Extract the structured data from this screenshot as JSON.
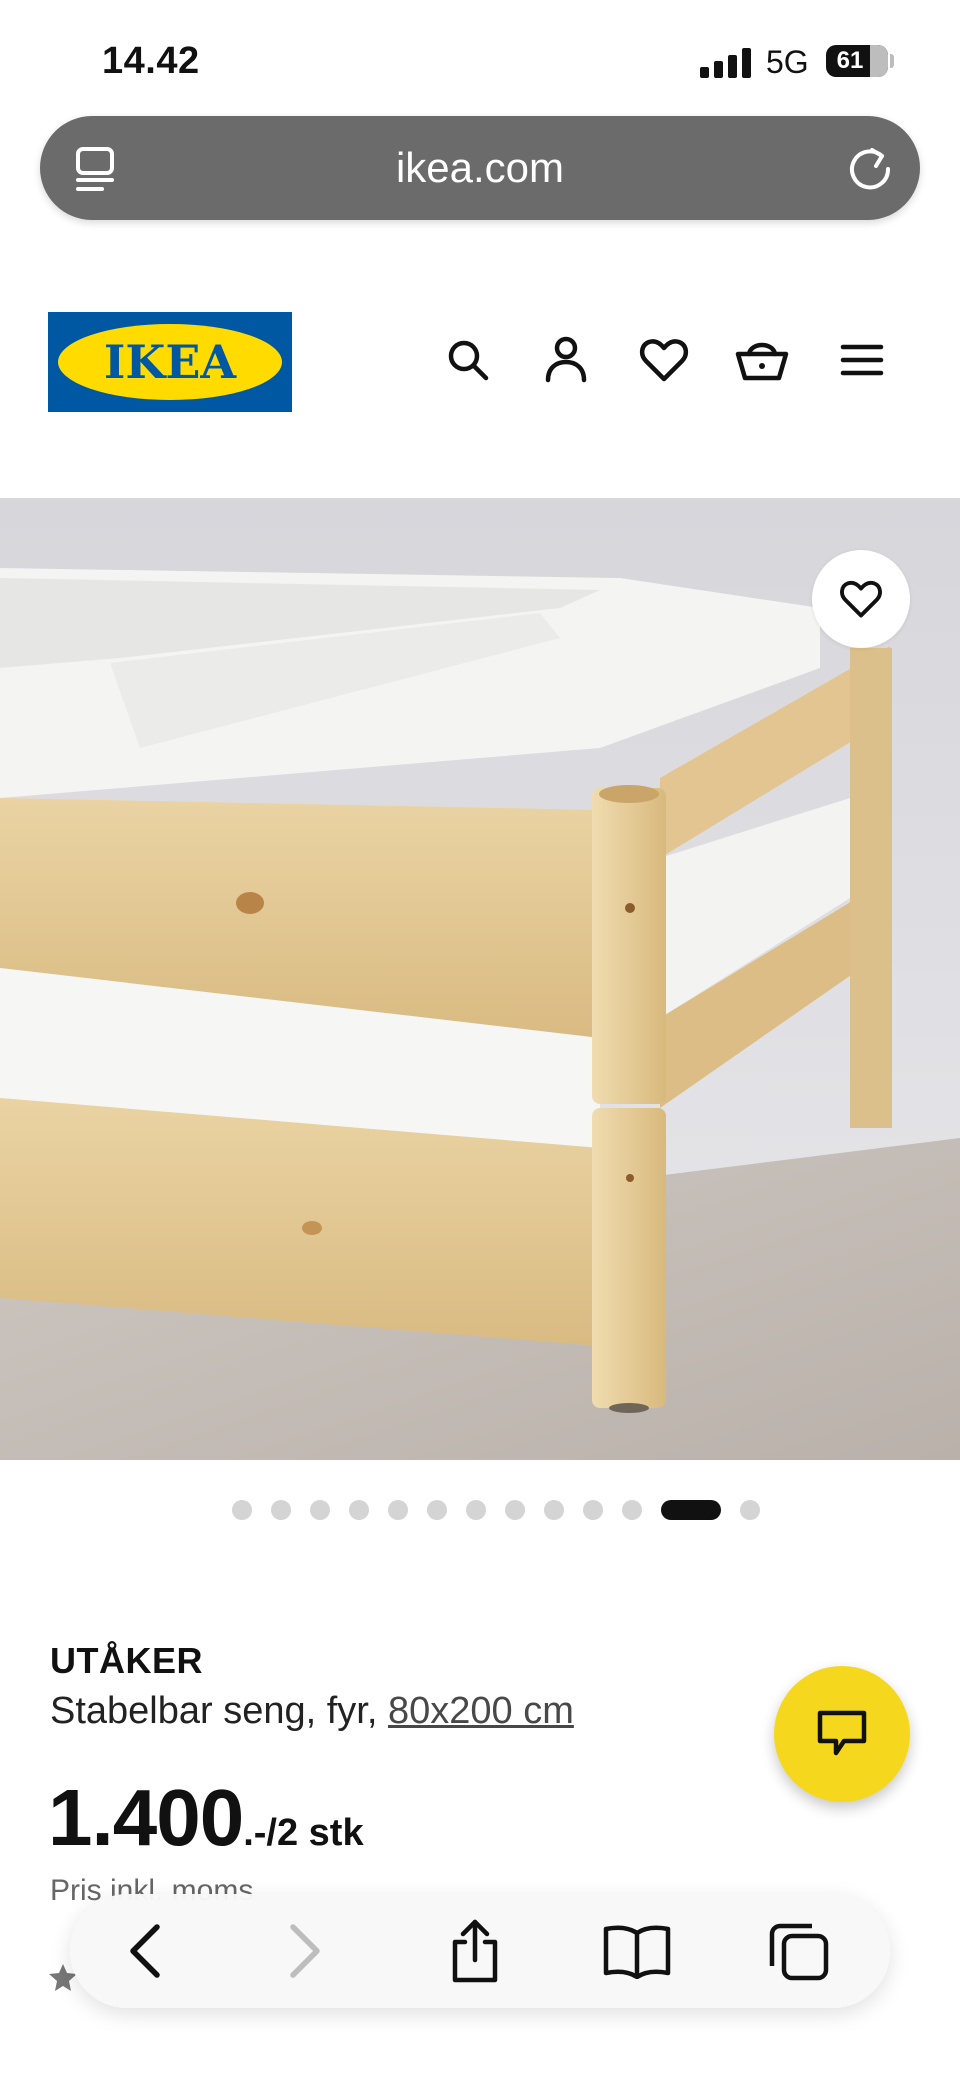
{
  "status_bar": {
    "time": "14.42",
    "network": "5G",
    "battery": "61",
    "battery_level_percent": 61
  },
  "url_bar": {
    "url": "ikea.com"
  },
  "header": {
    "logo_text": "IKEA",
    "icons": [
      "search-icon",
      "account-icon",
      "heart-icon",
      "basket-icon",
      "menu-icon"
    ]
  },
  "gallery": {
    "dot_count": 13,
    "active_index": 11
  },
  "product": {
    "name": "UTÅKER",
    "description_prefix": "Stabelbar seng, fyr, ",
    "size_link": "80x200 cm",
    "price_main": "1.400",
    "price_suffix": ".-/2 stk",
    "price_note": "Pris inkl. moms"
  },
  "colors": {
    "ikea_blue": "#0058a3",
    "ikea_yellow": "#ffdb00",
    "chat_yellow": "#f5d81e",
    "url_bar_gray": "#6b6b6b"
  },
  "toolbar": {
    "icons": [
      "back-icon",
      "forward-icon",
      "share-icon",
      "bookmarks-icon",
      "tabs-icon"
    ]
  }
}
